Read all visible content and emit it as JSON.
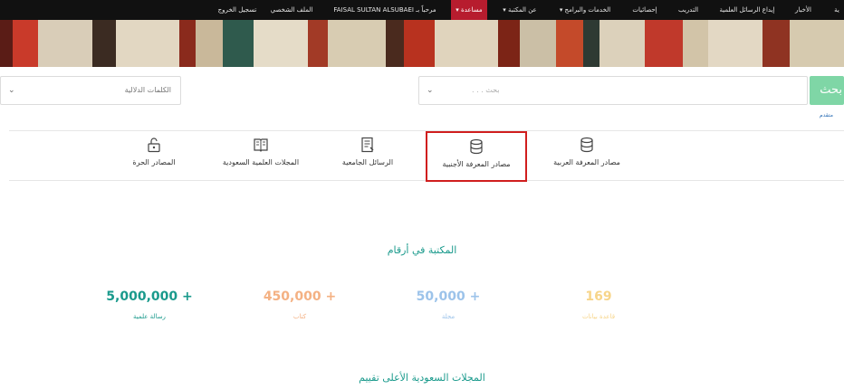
{
  "nav": {
    "items": [
      {
        "label": "ية"
      },
      {
        "label": "الأخبار"
      },
      {
        "label": "إيداع الرسائل العلمية"
      },
      {
        "label": "التدريب"
      },
      {
        "label": "إحصائيات"
      },
      {
        "label": "الخدمات والبرامج ▾"
      },
      {
        "label": "عن المكتبة ▾"
      },
      {
        "label": "مساعدة ▾"
      },
      {
        "label": "مرحباً بـ FAISAL SULTAN ALSUBAEI"
      },
      {
        "label": "الملف الشخصي"
      },
      {
        "label": "تسجيل الخروج"
      }
    ]
  },
  "search": {
    "button_label": "بحث",
    "query_placeholder": "بحث . . .",
    "keywords_label": "الكلمات الدلالية",
    "chevron": "⌄",
    "advanced_link": "متقدم"
  },
  "categories": [
    {
      "label": "مصادر المعرفة العربية",
      "icon": "database-icon"
    },
    {
      "label": "مصادر المعرفة الأجنبية",
      "icon": "database-icon"
    },
    {
      "label": "الرسائل الجامعية",
      "icon": "document-icon"
    },
    {
      "label": "المجلات العلمية السعودية",
      "icon": "journal-icon"
    },
    {
      "label": "المصادر الحرة",
      "icon": "unlock-icon"
    }
  ],
  "stats": {
    "title": "المكتبة في أرقام",
    "items": [
      {
        "number": "5,000,000 +",
        "label": "رسالة علمية",
        "color": "#1a9a8c"
      },
      {
        "number": "450,000 +",
        "label": "كتاب",
        "color": "#f4b183"
      },
      {
        "number": "50,000 +",
        "label": "مجلة",
        "color": "#9cc3ea"
      },
      {
        "number": "169",
        "label": "قاعدة بيانات",
        "color": "#f7d58a"
      }
    ]
  },
  "ratings_title": "المجلات السعودية الأعلى تقييم",
  "colors": {
    "accent": "#1a9a8c",
    "highlight_border": "#d01e1e",
    "search_button": "#7fd6a6",
    "active_nav": "#b71c2e"
  }
}
